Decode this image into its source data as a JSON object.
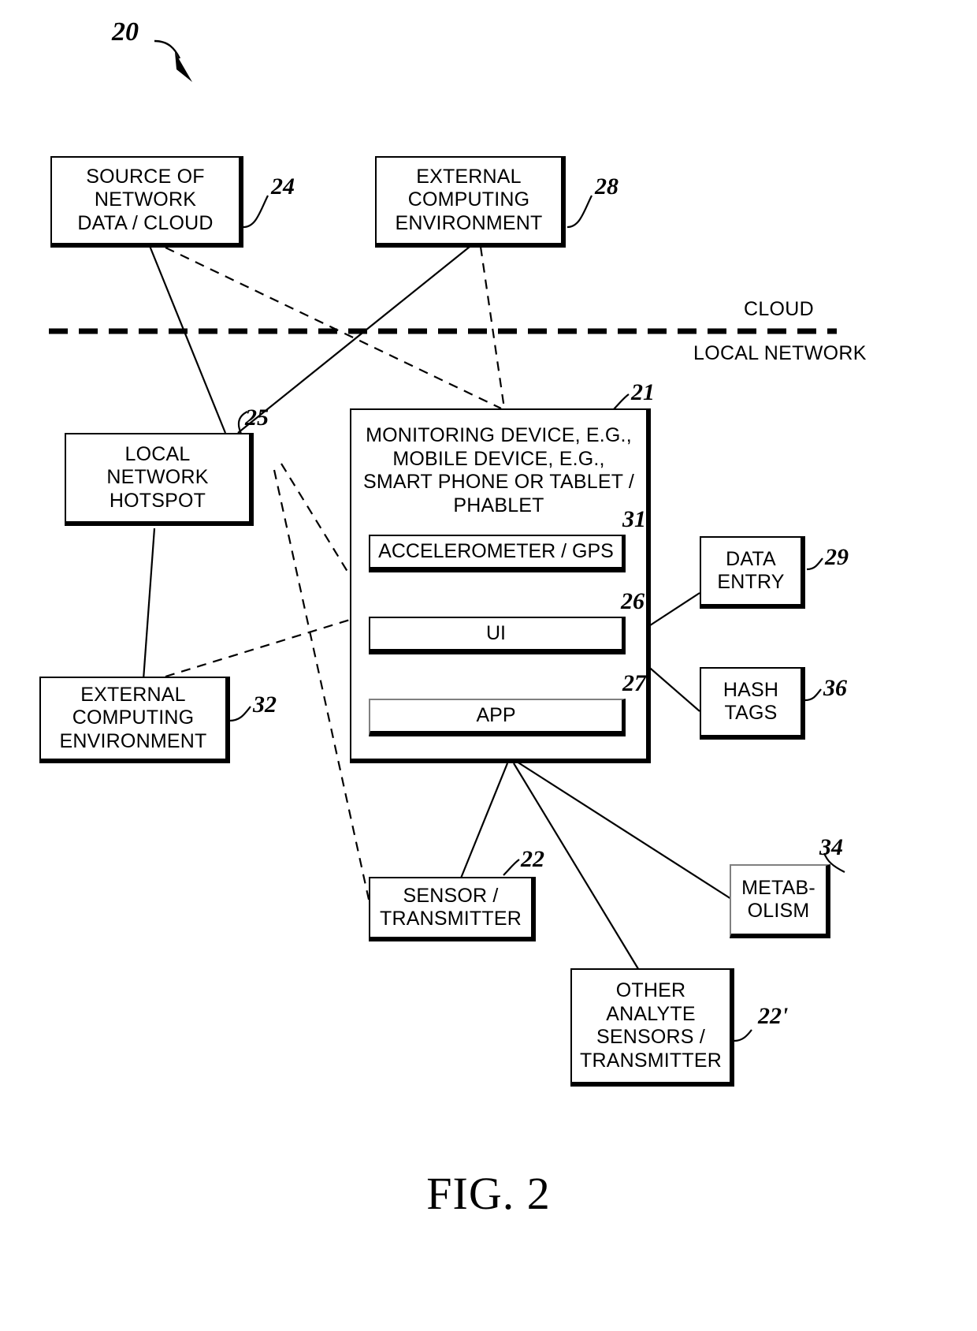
{
  "figure": {
    "caption": "FIG. 2",
    "figure_ref": "20",
    "divider_top_label": "CLOUD",
    "divider_bottom_label": "LOCAL NETWORK"
  },
  "nodes": {
    "source_network_data": {
      "label": "SOURCE OF\nNETWORK\nDATA / CLOUD",
      "ref": "24"
    },
    "external_computing_environment_cloud": {
      "label": "EXTERNAL\nCOMPUTING\nENVIRONMENT",
      "ref": "28"
    },
    "local_network_hotspot": {
      "label": "LOCAL\nNETWORK\nHOTSPOT",
      "ref": "25"
    },
    "external_computing_environment_local": {
      "label": "EXTERNAL\nCOMPUTING\nENVIRONMENT",
      "ref": "32"
    },
    "monitoring_device": {
      "label": "MONITORING DEVICE, E.G.,\nMOBILE DEVICE, E.G.,\nSMART PHONE OR TABLET /\nPHABLET",
      "ref": "21"
    },
    "accelerometer_gps": {
      "label": "ACCELEROMETER / GPS",
      "ref": "31"
    },
    "ui": {
      "label": "UI",
      "ref": "26"
    },
    "app": {
      "label": "APP",
      "ref": "27"
    },
    "data_entry": {
      "label": "DATA\nENTRY",
      "ref": "29"
    },
    "hash_tags": {
      "label": "HASH\nTAGS",
      "ref": "36"
    },
    "sensor_transmitter": {
      "label": "SENSOR /\nTRANSMITTER",
      "ref": "22"
    },
    "metabolism": {
      "label": "METAB-\nOLISM",
      "ref": "34"
    },
    "other_analyte_sensors": {
      "label": "OTHER\nANALYTE\nSENSORS /\nTRANSMITTER",
      "ref": "22'"
    }
  },
  "colors": {
    "stroke": "#000000",
    "background": "#ffffff"
  }
}
